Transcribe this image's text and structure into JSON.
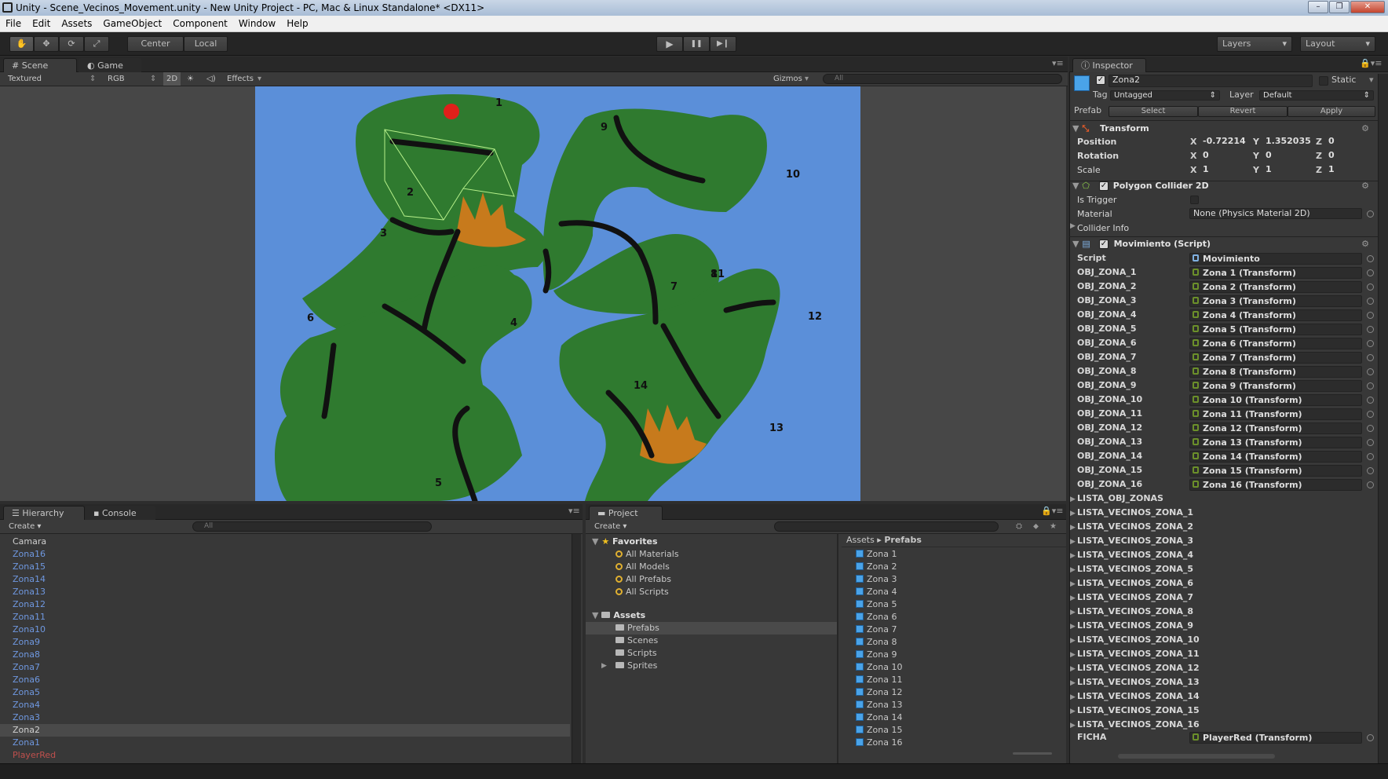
{
  "window": {
    "title": "Unity - Scene_Vecinos_Movement.unity - New Unity Project - PC, Mac & Linux Standalone* <DX11>",
    "controls": [
      "–",
      "❐",
      "✕"
    ]
  },
  "menu": [
    "File",
    "Edit",
    "Assets",
    "GameObject",
    "Component",
    "Window",
    "Help"
  ],
  "toolbar": {
    "pivot_label": "Center",
    "space_label": "Local",
    "layers_label": "Layers",
    "layout_label": "Layout",
    "play_icon": "▶",
    "pause_icon": "❚❚",
    "step_icon": "▶❙"
  },
  "scene": {
    "tabs": [
      "Scene",
      "Game"
    ],
    "render_mode": "Textured",
    "color_mode": "RGB",
    "mode_2d": "2D",
    "effects": "Effects",
    "gizmos": "Gizmos",
    "search_placeholder": "All",
    "zone_numbers": [
      "1",
      "2",
      "3",
      "4",
      "5",
      "6",
      "7",
      "8",
      "9",
      "10",
      "11",
      "12",
      "13",
      "14"
    ],
    "colors": {
      "water": "#5b8fd9",
      "land": "#2f7a2f",
      "border": "#111111",
      "player": "#e0201a",
      "mountain": "#c77a1c"
    }
  },
  "hierarchy": {
    "tabs": [
      "Hierarchy",
      "Console"
    ],
    "create_label": "Create",
    "search_placeholder": "All",
    "items": [
      {
        "label": "Camara",
        "kind": "normal"
      },
      {
        "label": "Zona16",
        "kind": "prefab"
      },
      {
        "label": "Zona15",
        "kind": "prefab"
      },
      {
        "label": "Zona14",
        "kind": "prefab"
      },
      {
        "label": "Zona13",
        "kind": "prefab"
      },
      {
        "label": "Zona12",
        "kind": "prefab"
      },
      {
        "label": "Zona11",
        "kind": "prefab"
      },
      {
        "label": "Zona10",
        "kind": "prefab"
      },
      {
        "label": "Zona9",
        "kind": "prefab"
      },
      {
        "label": "Zona8",
        "kind": "prefab"
      },
      {
        "label": "Zona7",
        "kind": "prefab"
      },
      {
        "label": "Zona6",
        "kind": "prefab"
      },
      {
        "label": "Zona5",
        "kind": "prefab"
      },
      {
        "label": "Zona4",
        "kind": "prefab"
      },
      {
        "label": "Zona3",
        "kind": "prefab"
      },
      {
        "label": "Zona2",
        "kind": "selected"
      },
      {
        "label": "Zona1",
        "kind": "prefab"
      },
      {
        "label": "PlayerRed",
        "kind": "broken"
      }
    ]
  },
  "project": {
    "tab": "Project",
    "create_label": "Create",
    "favorites_label": "Favorites",
    "favorites": [
      "All Materials",
      "All Models",
      "All Prefabs",
      "All Scripts"
    ],
    "assets_label": "Assets",
    "folders": [
      "Prefabs",
      "Scenes",
      "Scripts",
      "Sprites"
    ],
    "breadcrumb_root": "Assets",
    "breadcrumb_current": "Prefabs",
    "files": [
      "Zona 1",
      "Zona 2",
      "Zona 3",
      "Zona 4",
      "Zona 5",
      "Zona 6",
      "Zona 7",
      "Zona 8",
      "Zona 9",
      "Zona 10",
      "Zona 11",
      "Zona 12",
      "Zona 13",
      "Zona 14",
      "Zona 15",
      "Zona 16"
    ]
  },
  "inspector": {
    "tab": "Inspector",
    "object_name": "Zona2",
    "static_label": "Static",
    "tag_label": "Tag",
    "tag_value": "Untagged",
    "layer_label": "Layer",
    "layer_value": "Default",
    "prefab_label": "Prefab",
    "prefab_buttons": [
      "Select",
      "Revert",
      "Apply"
    ],
    "transform": {
      "title": "Transform",
      "rows": [
        {
          "label": "Position",
          "x": "-0.72214",
          "y": "1.352035",
          "z": "0"
        },
        {
          "label": "Rotation",
          "x": "0",
          "y": "0",
          "z": "0"
        },
        {
          "label": "Scale",
          "x": "1",
          "y": "1",
          "z": "1"
        }
      ]
    },
    "collider": {
      "title": "Polygon Collider 2D",
      "is_trigger_label": "Is Trigger",
      "material_label": "Material",
      "material_value": "None (Physics Material 2D)",
      "info_label": "Collider Info"
    },
    "script_component": {
      "title": "Movimiento (Script)",
      "script_label": "Script",
      "script_value": "Movimiento",
      "fields": [
        {
          "label": "OBJ_ZONA_1",
          "value": "Zona 1 (Transform)"
        },
        {
          "label": "OBJ_ZONA_2",
          "value": "Zona 2 (Transform)"
        },
        {
          "label": "OBJ_ZONA_3",
          "value": "Zona 3 (Transform)"
        },
        {
          "label": "OBJ_ZONA_4",
          "value": "Zona 4 (Transform)"
        },
        {
          "label": "OBJ_ZONA_5",
          "value": "Zona 5 (Transform)"
        },
        {
          "label": "OBJ_ZONA_6",
          "value": "Zona 6 (Transform)"
        },
        {
          "label": "OBJ_ZONA_7",
          "value": "Zona 7 (Transform)"
        },
        {
          "label": "OBJ_ZONA_8",
          "value": "Zona 8 (Transform)"
        },
        {
          "label": "OBJ_ZONA_9",
          "value": "Zona 9 (Transform)"
        },
        {
          "label": "OBJ_ZONA_10",
          "value": "Zona 10 (Transform)"
        },
        {
          "label": "OBJ_ZONA_11",
          "value": "Zona 11 (Transform)"
        },
        {
          "label": "OBJ_ZONA_12",
          "value": "Zona 12 (Transform)"
        },
        {
          "label": "OBJ_ZONA_13",
          "value": "Zona 13 (Transform)"
        },
        {
          "label": "OBJ_ZONA_14",
          "value": "Zona 14 (Transform)"
        },
        {
          "label": "OBJ_ZONA_15",
          "value": "Zona 15 (Transform)"
        },
        {
          "label": "OBJ_ZONA_16",
          "value": "Zona 16 (Transform)"
        }
      ],
      "lists": [
        "LISTA_OBJ_ZONAS",
        "LISTA_VECINOS_ZONA_1",
        "LISTA_VECINOS_ZONA_2",
        "LISTA_VECINOS_ZONA_3",
        "LISTA_VECINOS_ZONA_4",
        "LISTA_VECINOS_ZONA_5",
        "LISTA_VECINOS_ZONA_6",
        "LISTA_VECINOS_ZONA_7",
        "LISTA_VECINOS_ZONA_8",
        "LISTA_VECINOS_ZONA_9",
        "LISTA_VECINOS_ZONA_10",
        "LISTA_VECINOS_ZONA_11",
        "LISTA_VECINOS_ZONA_12",
        "LISTA_VECINOS_ZONA_13",
        "LISTA_VECINOS_ZONA_14",
        "LISTA_VECINOS_ZONA_15",
        "LISTA_VECINOS_ZONA_16"
      ],
      "ficha_label": "FICHA",
      "ficha_value": "PlayerRed (Transform)"
    }
  }
}
